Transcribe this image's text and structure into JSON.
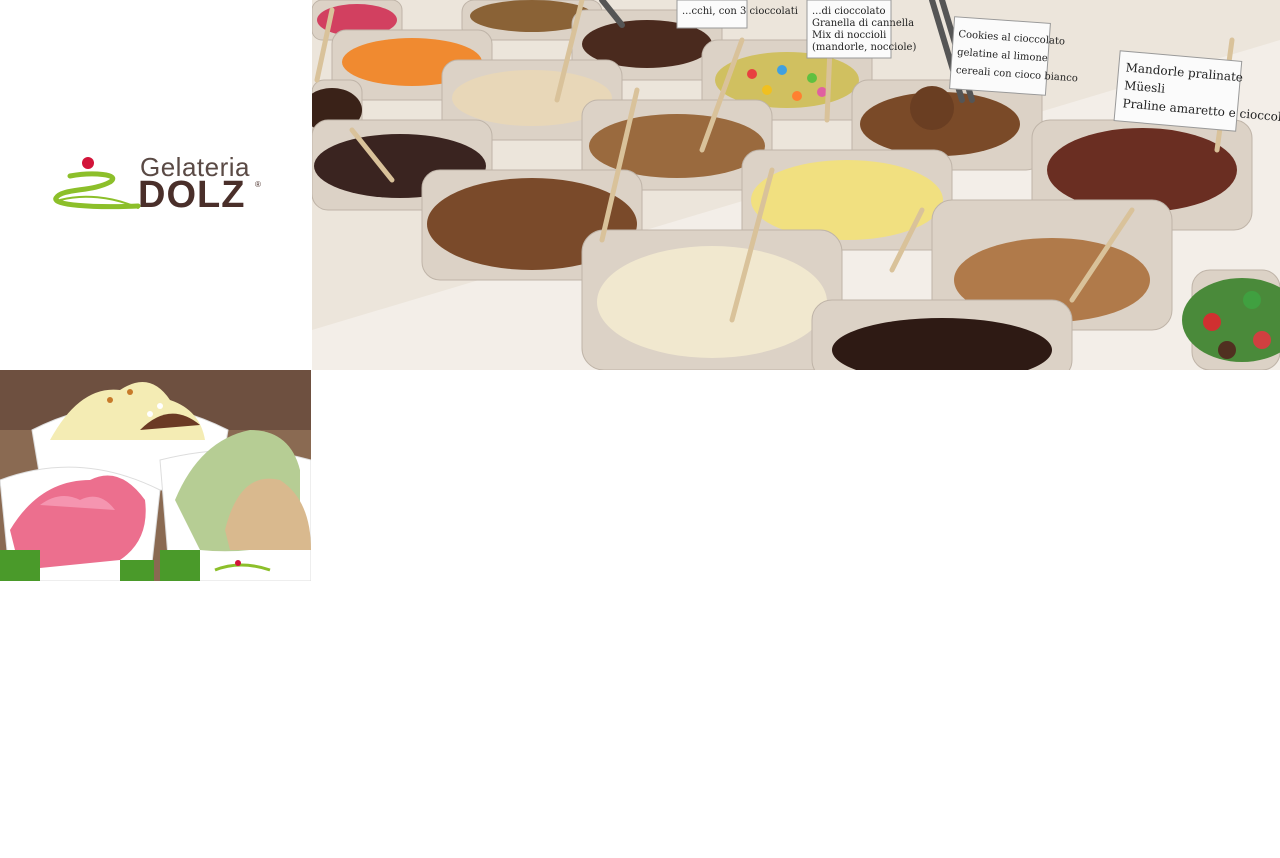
{
  "brand": {
    "line1": "Gelateria",
    "line2": "DOLZ",
    "mark": "®",
    "colors": {
      "green": "#8cbf2a",
      "red": "#d2143a",
      "brown": "#4a2f2a"
    }
  },
  "banner": {
    "labels": [
      "...cchi, con 3 cioccolati",
      "...di cioccolato\nGranella di cannella\nMix di noccioli\n(mandorle, nocciole)",
      "Cookies al cioccolato\ngelatine al limone\ncereali con cioco bianco",
      "Mandorle pralinate\nMüesli\nPraline amaretto e cioccolato"
    ]
  }
}
